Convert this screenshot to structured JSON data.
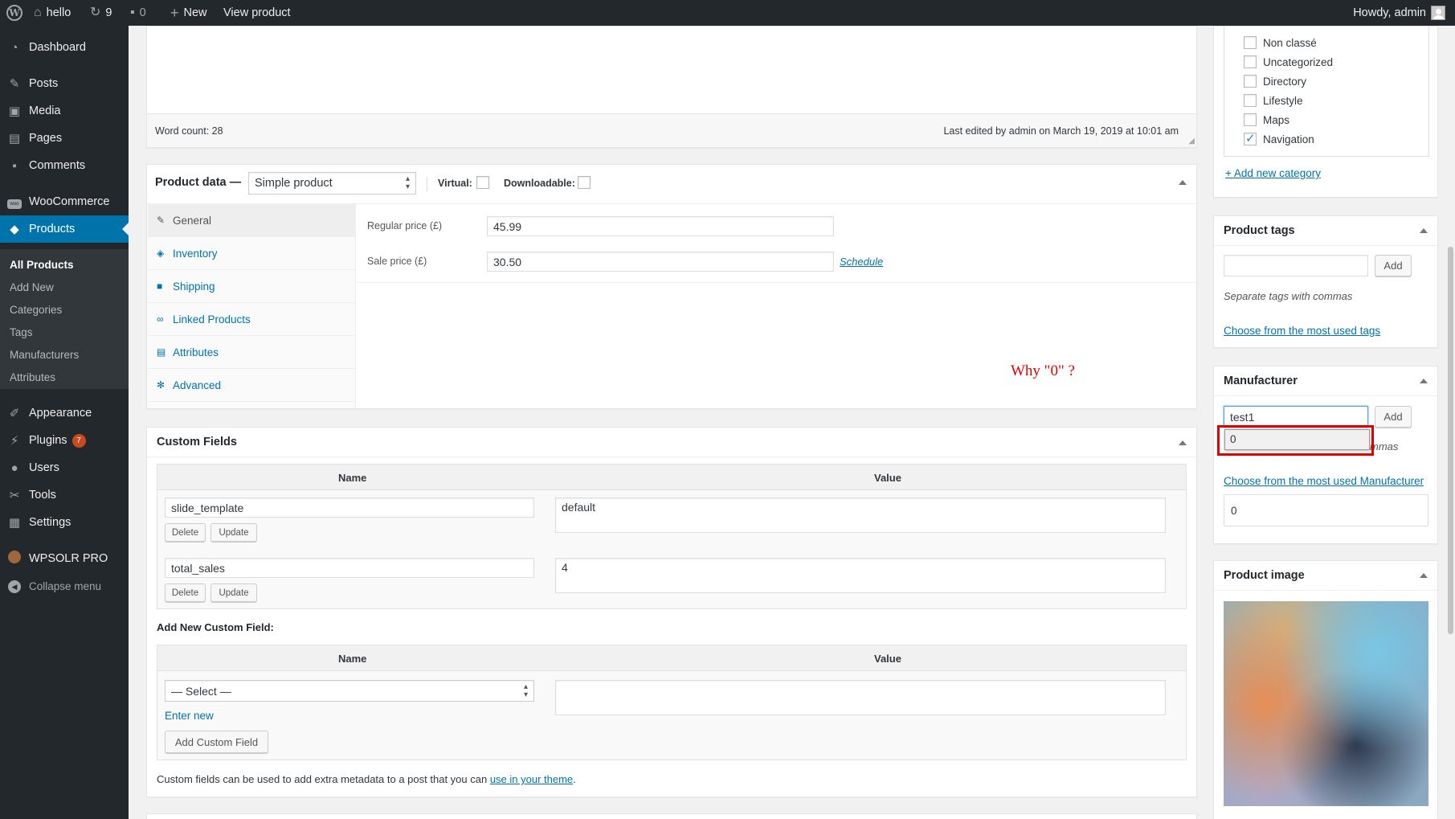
{
  "admin_bar": {
    "site_name": "hello",
    "updates_count": "9",
    "comments_count": "0",
    "new_label": "New",
    "view_product": "View product",
    "howdy": "Howdy, admin"
  },
  "sidebar": {
    "dashboard": "Dashboard",
    "posts": "Posts",
    "media": "Media",
    "pages": "Pages",
    "comments": "Comments",
    "woocommerce": "WooCommerce",
    "products": "Products",
    "submenu": [
      "All Products",
      "Add New",
      "Categories",
      "Tags",
      "Manufacturers",
      "Attributes"
    ],
    "appearance": "Appearance",
    "plugins": "Plugins",
    "plugins_badge": "7",
    "users": "Users",
    "tools": "Tools",
    "settings": "Settings",
    "wpsolr": "WPSOLR PRO",
    "collapse": "Collapse menu"
  },
  "editor": {
    "word_count": "Word count: 28",
    "last_edited": "Last edited by admin on March 19, 2019 at 10:01 am"
  },
  "product_data": {
    "title": "Product data —",
    "type_selected": "Simple product",
    "virtual_label": "Virtual:",
    "downloadable_label": "Downloadable:",
    "tabs": [
      "General",
      "Inventory",
      "Shipping",
      "Linked Products",
      "Attributes",
      "Advanced"
    ],
    "regular_price_label": "Regular price (£)",
    "regular_price_value": "45.99",
    "sale_price_label": "Sale price (£)",
    "sale_price_value": "30.50",
    "schedule_link": "Schedule",
    "annotation": "Why \"0\" ?"
  },
  "custom_fields": {
    "title": "Custom Fields",
    "col_name": "Name",
    "col_value": "Value",
    "rows": [
      {
        "name": "slide_template",
        "value": "default"
      },
      {
        "name": "total_sales",
        "value": "4"
      }
    ],
    "delete_label": "Delete",
    "update_label": "Update",
    "add_new_heading": "Add New Custom Field:",
    "select_placeholder": "— Select —",
    "enter_new": "Enter new",
    "add_button": "Add Custom Field",
    "footer_text": "Custom fields can be used to add extra metadata to a post that you can ",
    "footer_link": "use in your theme",
    "footer_end": "."
  },
  "categories": {
    "items": [
      {
        "label": "Non classé",
        "checked": false
      },
      {
        "label": "Uncategorized",
        "checked": false
      },
      {
        "label": "Directory",
        "checked": false
      },
      {
        "label": "Lifestyle",
        "checked": false
      },
      {
        "label": "Maps",
        "checked": false
      },
      {
        "label": "Navigation",
        "checked": true
      }
    ],
    "add_new": "+ Add new category"
  },
  "product_tags": {
    "title": "Product tags",
    "add_label": "Add",
    "hint": "Separate tags with commas",
    "choose_link": "Choose from the most used tags"
  },
  "manufacturer": {
    "title": "Manufacturer",
    "input_value": "test1",
    "add_label": "Add",
    "suggestion": "0",
    "hint_partial": "mmas",
    "choose_link": "Choose from the most used Manufacturer",
    "box_value": "0"
  },
  "product_image": {
    "title": "Product image"
  },
  "colors": {
    "admin_dark": "#23282d",
    "accent_blue": "#0073aa",
    "highlight_red": "#e00000"
  }
}
